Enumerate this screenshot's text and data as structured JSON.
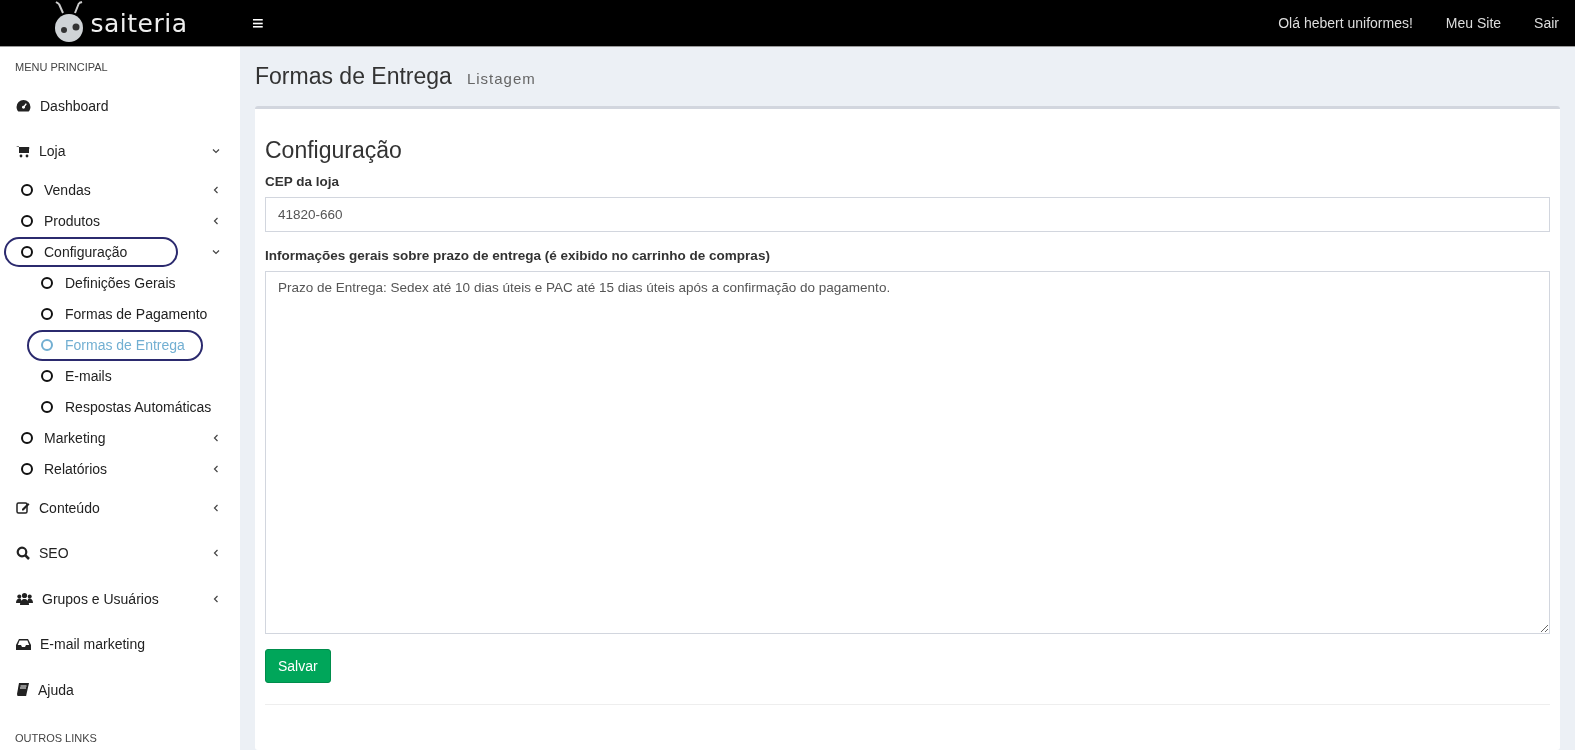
{
  "header": {
    "logo_text": "saiteria",
    "menu_toggle": "≡",
    "links": [
      {
        "label": "Olá hebert uniformes!"
      },
      {
        "label": "Meu Site"
      },
      {
        "label": "Sair"
      }
    ]
  },
  "sidebar": {
    "heading": "MENU PRINCIPAL",
    "items": [
      {
        "label": "Dashboard",
        "selected": false
      },
      {
        "label": "Loja",
        "selected": false,
        "expanded": true,
        "children": [
          {
            "label": "Vendas",
            "selected": false,
            "circled": false,
            "expanded": false
          },
          {
            "label": "Produtos",
            "selected": false,
            "circled": false,
            "expanded": false
          },
          {
            "label": "Configuração",
            "selected": false,
            "circled": true,
            "expanded": true,
            "children": [
              {
                "label": "Definições Gerais",
                "selected": false,
                "circled": false
              },
              {
                "label": "Formas de Pagamento",
                "selected": false,
                "circled": false
              },
              {
                "label": "Formas de Entrega",
                "selected": true,
                "circled": true
              },
              {
                "label": "E-mails",
                "selected": false,
                "circled": false
              },
              {
                "label": "Respostas Automáticas",
                "selected": false,
                "circled": false
              }
            ]
          },
          {
            "label": "Marketing",
            "selected": false,
            "circled": false,
            "expanded": false
          },
          {
            "label": "Relatórios",
            "selected": false,
            "circled": false,
            "expanded": false
          }
        ]
      },
      {
        "label": "Conteúdo",
        "selected": false,
        "expanded": false
      },
      {
        "label": "SEO",
        "selected": false,
        "expanded": false
      },
      {
        "label": "Grupos e Usuários",
        "selected": false,
        "expanded": false
      },
      {
        "label": "E-mail marketing",
        "selected": false
      },
      {
        "label": "Ajuda",
        "selected": false
      }
    ],
    "footer_heading": "OUTROS LINKS"
  },
  "page": {
    "title": "Formas de Entrega",
    "subtitle": "Listagem"
  },
  "form": {
    "title": "Configuração",
    "cep": {
      "label": "CEP da loja",
      "value": "41820-660"
    },
    "info": {
      "label": "Informações gerais sobre prazo de entrega (é exibido no carrinho de compras)",
      "value": "Prazo de Entrega: Sedex até 10 dias úteis e PAC até 15 dias úteis após a confirmação do pagamento."
    },
    "submit": "Salvar"
  }
}
